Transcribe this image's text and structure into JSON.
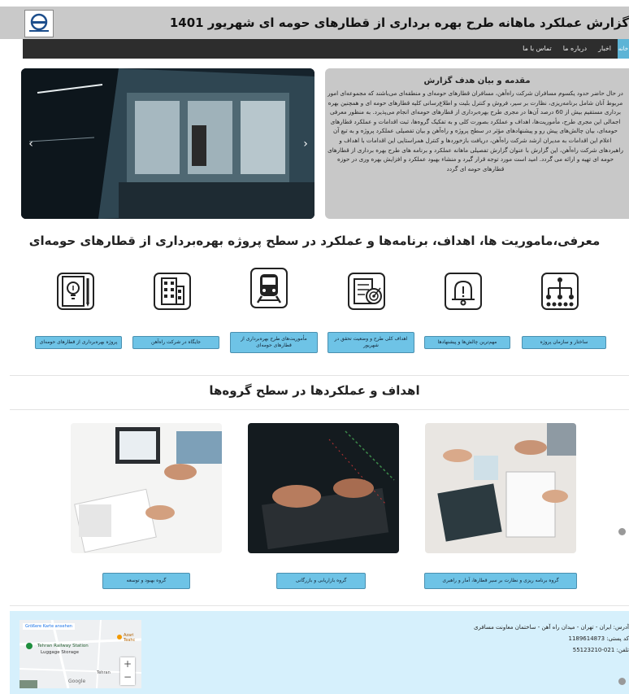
{
  "header": {
    "title": "گزارش عملکرد ماهانه طرح بهره برداری از قطارهای حومه ای شهریور 1401"
  },
  "nav": {
    "active_label": "خانه",
    "items": [
      "اخبار",
      "درباره ما",
      "تماس با ما"
    ]
  },
  "slider": {
    "prev_label": "‹",
    "next_label": "›"
  },
  "intro": {
    "title": "مقدمه و بیان هدف گزارش",
    "body": "در حال حاضر حدود یکسوم مسافران شرکت راه‌آهن، مسافران قطارهای حومه‌ای و منطقه‌ای می‌باشند که مجموعه‌ای امور مربوط آنان شامل برنامه‌ریزی، نظارت بر سیر، فروش و کنترل بلیت و اطلاع‌رسانی کلیه قطارهای حومه ای و همچنین بهره برداری مستقیم بیش از 60 درصد آن‌ها در مجری طرح بهره‌برداری از قطارهای حومه‌ای انجام می‌پذیرد. به منظور معرفی اجمالی این مجری طرح، مأموریت‌ها، اهداف و عملکرد بصورت کلی و به تفکیک گروه‌ها، ثبت اقدامات و عملکرد قطارهای حومه‌ای، بیان چالش‌های پیش رو و پیشنهادهای مؤثر در سطح پروژه و راه‌آهن و بیان تفصیلی عملکرد پروژه و به تبع آن اعلام این اقدامات به مدیران ارشد شرکت راه‌آهن، دریافت بازخوردها و کنترل همراستایی این اقدامات با اهداف و راهبردهای شرکت راه‌آهن، این گزارش با عنوان گزارش تفصیلی ماهانه عملکرد و برنامه های طرح بهره برداری از قطارهای حومه ای تهیه و ارائه می گردد. امید است مورد توجه قرار گیرد و منشاء بهبود عملکرد و افزایش بهره وری در حوزه قطارهای حومه ای گردد"
  },
  "section1": {
    "title": "معرفی،ماموریت ها، اهداف، برنامه‌ها و عملکرد در سطح پروژه بهره‌برداری از قطارهای حومه‌ای",
    "items": [
      {
        "label": "ساختار و سازمان پروژه",
        "icon": "org-chart-icon"
      },
      {
        "label": "مهم‌ترین چالش‌ها و پیشنهادها",
        "icon": "bell-icon"
      },
      {
        "label": "اهداف کلی طرح و وضعیت تحقق در شهریور",
        "icon": "target-checklist-icon"
      },
      {
        "label": "مأموریت‌های طرح بهره‌برداری از قطارهای حومه‌ای",
        "icon": "train-icon"
      },
      {
        "label": "جایگاه در شرکت راه‌آهن",
        "icon": "building-icon"
      },
      {
        "label": "پروژه بهره‌برداری از قطارهای حومه‌ای",
        "icon": "document-idea-icon"
      }
    ]
  },
  "section2": {
    "title": "اهداف و عملکردها در سطح گروه‌ها",
    "groups": [
      {
        "label": "گروه برنامه ریزی و نظارت بر سیر قطارها، آمار و راهبری"
      },
      {
        "label": "گروه بازاریابی و بازرگانی"
      },
      {
        "label": "گروه بهبود و توسعه"
      }
    ]
  },
  "footer": {
    "address": "آدرس: ایران - تهران - میدان راه آهن - ساختمان معاونت مسافری",
    "postal": "کد پستی: 1189614873",
    "phone": "تلفن: 021-55123210",
    "map_enlarge": "Größere Karte ansehen",
    "map_place": "Tehran Railway Station",
    "map_place_sub": "Luggage Storage",
    "map_poi": "Azari Teahc",
    "map_area": "Tehran",
    "map_provider": "Google"
  }
}
